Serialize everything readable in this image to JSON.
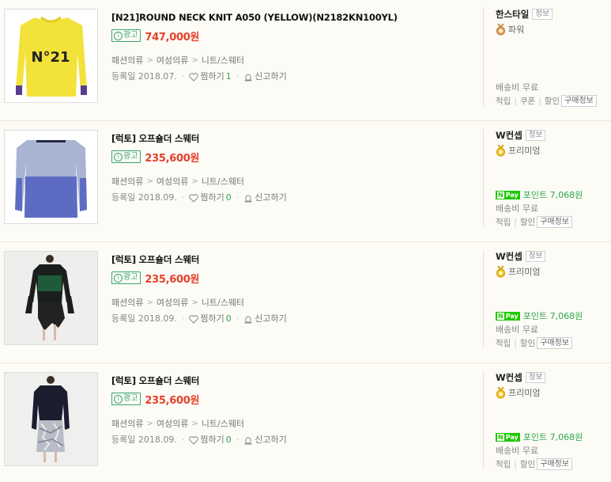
{
  "products": [
    {
      "title": "[N21]ROUND NECK KNIT A050 (YELLOW)(N2182KN100YL)",
      "ad_label": "광고",
      "price": "747,000원",
      "categories": [
        "패션의류",
        "여성의류",
        "니트/스웨터"
      ],
      "reg_date": "등록일 2018.07.",
      "wish_label": "찜하기",
      "wish_count": "1",
      "report_label": "신고하기",
      "seller_name": "한스타일",
      "seller_info_label": "정보",
      "grade": "파워",
      "npay_points": "",
      "shipping": "배송비 무료",
      "benefits": [
        "적립",
        "쿠폰",
        "할인"
      ],
      "buy_info_label": "구매정보",
      "image_icon": "yellow-sweater-image"
    },
    {
      "title": "[럭토] 오프숄더 스웨터",
      "ad_label": "광고",
      "price": "235,600원",
      "categories": [
        "패션의류",
        "여성의류",
        "니트/스웨터"
      ],
      "reg_date": "등록일 2018.09.",
      "wish_label": "찜하기",
      "wish_count": "0",
      "report_label": "신고하기",
      "seller_name": "W컨셉",
      "seller_info_label": "정보",
      "grade": "프리미엄",
      "npay_points": "포인트 7,068원",
      "shipping": "배송비 무료",
      "benefits": [
        "적립",
        "할인"
      ],
      "buy_info_label": "구매정보",
      "image_icon": "blue-sweater-image"
    },
    {
      "title": "[럭토] 오프숄더 스웨터",
      "ad_label": "광고",
      "price": "235,600원",
      "categories": [
        "패션의류",
        "여성의류",
        "니트/스웨터"
      ],
      "reg_date": "등록일 2018.09.",
      "wish_label": "찜하기",
      "wish_count": "0",
      "report_label": "신고하기",
      "seller_name": "W컨셉",
      "seller_info_label": "정보",
      "grade": "프리미엄",
      "npay_points": "포인트 7,068원",
      "shipping": "배송비 무료",
      "benefits": [
        "적립",
        "할인"
      ],
      "buy_info_label": "구매정보",
      "image_icon": "model-green-sweater-image"
    },
    {
      "title": "[럭토] 오프숄더 스웨터",
      "ad_label": "광고",
      "price": "235,600원",
      "categories": [
        "패션의류",
        "여성의류",
        "니트/스웨터"
      ],
      "reg_date": "등록일 2018.09.",
      "wish_label": "찜하기",
      "wish_count": "0",
      "report_label": "신고하기",
      "seller_name": "W컨셉",
      "seller_info_label": "정보",
      "grade": "프리미엄",
      "npay_points": "포인트 7,068원",
      "shipping": "배송비 무료",
      "benefits": [
        "적립",
        "할인"
      ],
      "buy_info_label": "구매정보",
      "image_icon": "model-navy-sweater-image"
    }
  ],
  "npay_logo": {
    "n": "N",
    "pay": "Pay"
  },
  "colors": {
    "price": "#e5422a",
    "ad_green": "#3aa76d",
    "npay_green": "#1ec800",
    "background": "#fcfbf6"
  }
}
